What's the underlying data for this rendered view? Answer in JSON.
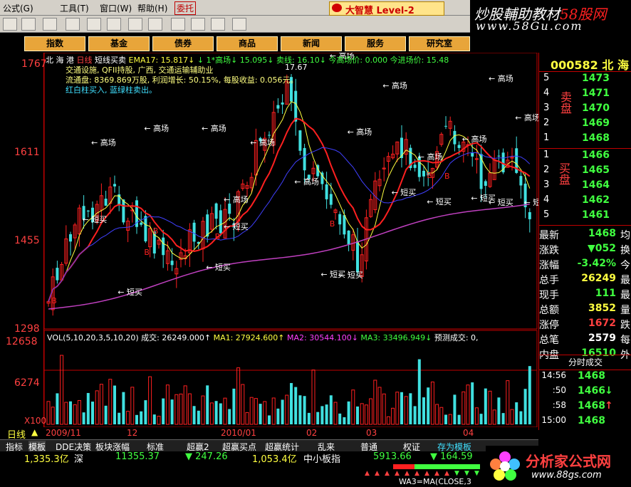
{
  "menu": [
    "公式(G)",
    "工具(T)",
    "窗口(W)",
    "帮助(H)"
  ],
  "menu_extra": "委托",
  "brand": "大智慧 Level-2",
  "watermark_top": {
    "title_a": "炒股輔助教材",
    "title_b": "58股网",
    "url": "www.58Gu.com"
  },
  "nav": [
    "指数",
    "基金",
    "债券",
    "商品",
    "新闻",
    "服务",
    "研究室"
  ],
  "chart_header": {
    "name": "北 海 港",
    "period": "日线",
    "indicator": "短线买卖",
    "ema": "EMA17: 15.817↓",
    "rest": "↓ 1*高场↓   15.095↓   卖线: 16.10↓    今高场价: 0.000   今进场价: 15.48",
    "hi_mark": "17.67"
  },
  "info_lines": [
    "交通设施, QFII持股, 广西, 交通运输辅助业",
    "流通盘: 8369.869万股, 利润增长: 50.15%, 每股收益: 0.056元。",
    "红白柱买入, 蓝绿柱卖出。"
  ],
  "y_labels": [
    "1767",
    "1611",
    "1455",
    "1298"
  ],
  "vol_header": {
    "label": "VOL(5,10,20,3,5,10,20)",
    "chengjiao": "成交: 26249.000↑",
    "ma1": "MA1: 27924.600↑",
    "ma2": "MA2: 30544.100↓",
    "ma3": "MA3: 33496.949↓",
    "predict": "预测成交: 0,"
  },
  "vol_labels": [
    "12658",
    "6274",
    "X100"
  ],
  "sell_label": "高场",
  "buy_label": "短买",
  "b_mark": "B",
  "timeframe": "日线",
  "dates": [
    "2009/11",
    "12",
    "2010/01",
    "02",
    "03",
    "04"
  ],
  "bottom_tabs": [
    "指标",
    "模板",
    "DDE决策",
    "板块涨幅",
    "标准",
    "超赢2",
    "超赢买点",
    "超赢统计",
    "乱来",
    "普通",
    "权证",
    "存为模板"
  ],
  "right_panel": {
    "code": "000582 北 海",
    "sell_side": "卖盘",
    "buy_side": "买盘",
    "sell_levels": [
      {
        "n": "5",
        "p": "1473"
      },
      {
        "n": "4",
        "p": "1471"
      },
      {
        "n": "3",
        "p": "1470"
      },
      {
        "n": "2",
        "p": "1469"
      },
      {
        "n": "1",
        "p": "1468"
      }
    ],
    "buy_levels": [
      {
        "n": "1",
        "p": "1466"
      },
      {
        "n": "2",
        "p": "1465"
      },
      {
        "n": "3",
        "p": "1464"
      },
      {
        "n": "4",
        "p": "1462"
      },
      {
        "n": "5",
        "p": "1461"
      }
    ],
    "stats": [
      {
        "l": "最新",
        "v": "1468",
        "r": "均",
        "c": "#40ff40"
      },
      {
        "l": "涨跌",
        "v": "▼052",
        "r": "换",
        "c": "#40ff40"
      },
      {
        "l": "涨幅",
        "v": "-3.42%",
        "r": "今",
        "c": "#40ff40"
      },
      {
        "l": "总手",
        "v": "26249",
        "r": "最",
        "c": "#ffff40"
      },
      {
        "l": "现手",
        "v": "111",
        "r": "最",
        "c": "#40ff40"
      },
      {
        "l": "总额",
        "v": "3852",
        "r": "量",
        "c": "#ffff40"
      },
      {
        "l": "涨停",
        "v": "1672",
        "r": "跌",
        "c": "#ff4040"
      },
      {
        "l": "总笔",
        "v": "2579",
        "r": "每",
        "c": "#ffffff"
      },
      {
        "l": "内盘",
        "v": "16510",
        "r": "外",
        "c": "#40ff40"
      }
    ],
    "fenshi": "分时成交",
    "ticks": [
      {
        "t": "14:56",
        "p": "1468",
        "a": ""
      },
      {
        "t": ":50",
        "p": "1466",
        "a": "↓"
      },
      {
        "t": ":58",
        "p": "1468",
        "a": "↑"
      },
      {
        "t": "15:00",
        "p": "1468",
        "a": ""
      }
    ]
  },
  "status": {
    "amt1": "1,335.3亿",
    "mkt1": "深",
    "idx1": "11355.37",
    "chg1": "▼ 247.26",
    "amt2": "1,053.4亿",
    "mkt2": "中小板指",
    "idx2": "5913.66",
    "chg2": "▼ 164.59",
    "formula": "WA3=MA(CLOSE,3"
  },
  "watermark_bottom": {
    "title": "分析家公式网",
    "url": "www.88gs.com"
  },
  "colors": {
    "up": "#ff2020",
    "down": "#40e0e0",
    "accent": "#e8a53a"
  }
}
